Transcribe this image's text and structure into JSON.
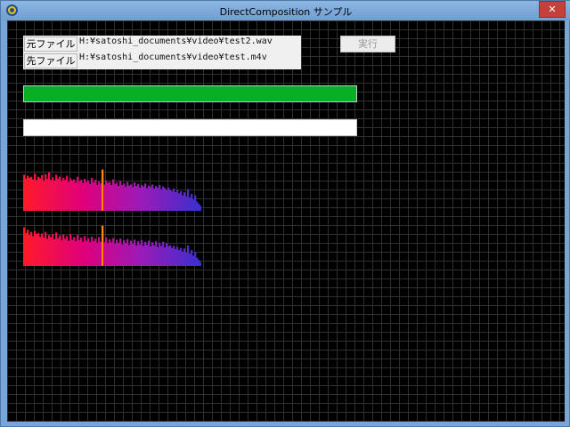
{
  "window": {
    "title": "DirectComposition サンプル",
    "close_glyph": "✕",
    "colors": {
      "titlebar": "#79a6d8",
      "close": "#c6403a",
      "background": "#000000",
      "grid": "#2f2f2f"
    }
  },
  "files": {
    "source": {
      "label": "元ファイル",
      "path": "H:¥satoshi_documents¥video¥test2.wav"
    },
    "dest": {
      "label": "先ファイル",
      "path": "H:¥satoshi_documents¥video¥test.m4v"
    }
  },
  "run_button": {
    "label": "実行",
    "enabled": false
  },
  "progress": [
    {
      "fraction": 1.0,
      "color": "#06b025"
    },
    {
      "fraction": 0.0,
      "color": "#06b025"
    }
  ],
  "spectrum": {
    "channels": [
      {
        "levels": [
          0.7,
          0.62,
          0.68,
          0.64,
          0.66,
          0.61,
          0.72,
          0.6,
          0.66,
          0.63,
          0.69,
          0.58,
          0.71,
          0.62,
          0.75,
          0.6,
          0.65,
          0.59,
          0.7,
          0.62,
          0.66,
          0.58,
          0.64,
          0.6,
          0.68,
          0.56,
          0.63,
          0.59,
          0.61,
          0.55,
          0.66,
          0.57,
          0.6,
          0.54,
          0.62,
          0.56,
          0.58,
          0.52,
          0.64,
          0.55,
          0.6,
          0.5,
          0.57,
          0.53,
          0.8,
          0.51,
          0.59,
          0.54,
          0.56,
          0.5,
          0.61,
          0.52,
          0.55,
          0.48,
          0.58,
          0.5,
          0.53,
          0.47,
          0.56,
          0.49,
          0.51,
          0.46,
          0.55,
          0.48,
          0.52,
          0.45,
          0.5,
          0.47,
          0.53,
          0.44,
          0.49,
          0.46,
          0.51,
          0.43,
          0.48,
          0.45,
          0.5,
          0.42,
          0.47,
          0.44,
          0.4,
          0.45,
          0.41,
          0.38,
          0.43,
          0.36,
          0.4,
          0.34,
          0.38,
          0.3,
          0.36,
          0.28,
          0.42,
          0.26,
          0.33,
          0.22,
          0.3,
          0.18,
          0.14,
          0.1
        ]
      },
      {
        "levels": [
          0.75,
          0.64,
          0.7,
          0.6,
          0.66,
          0.58,
          0.68,
          0.62,
          0.64,
          0.57,
          0.63,
          0.55,
          0.66,
          0.53,
          0.6,
          0.56,
          0.62,
          0.52,
          0.65,
          0.54,
          0.59,
          0.5,
          0.61,
          0.53,
          0.58,
          0.49,
          0.62,
          0.51,
          0.56,
          0.48,
          0.6,
          0.5,
          0.55,
          0.47,
          0.58,
          0.49,
          0.54,
          0.46,
          0.57,
          0.48,
          0.53,
          0.45,
          0.56,
          0.47,
          0.78,
          0.46,
          0.55,
          0.44,
          0.52,
          0.46,
          0.54,
          0.43,
          0.51,
          0.45,
          0.53,
          0.42,
          0.5,
          0.44,
          0.52,
          0.41,
          0.49,
          0.43,
          0.51,
          0.4,
          0.48,
          0.42,
          0.5,
          0.39,
          0.47,
          0.41,
          0.49,
          0.38,
          0.46,
          0.4,
          0.48,
          0.37,
          0.45,
          0.39,
          0.47,
          0.36,
          0.44,
          0.38,
          0.4,
          0.35,
          0.39,
          0.33,
          0.37,
          0.31,
          0.35,
          0.28,
          0.34,
          0.26,
          0.4,
          0.24,
          0.31,
          0.2,
          0.27,
          0.16,
          0.12,
          0.08
        ]
      }
    ],
    "highlight_index": 44,
    "highlight_color": "#ff8a00",
    "gradient": [
      "#ff1a2b",
      "#e0007a",
      "#9a1bb8",
      "#3b2fd0"
    ]
  }
}
